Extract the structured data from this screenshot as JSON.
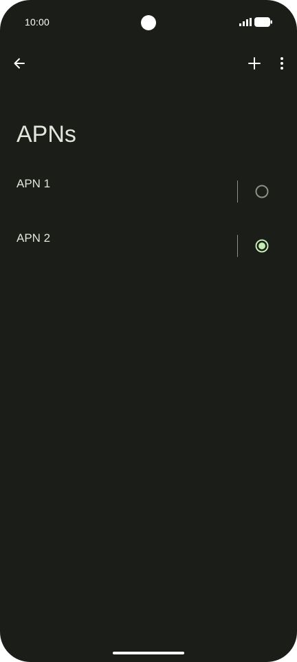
{
  "status_bar": {
    "time": "10:00"
  },
  "app_bar": {
    "back_icon": "arrow-back-icon",
    "add_icon": "add-icon",
    "more_icon": "more-vert-icon"
  },
  "page": {
    "title": "APNs"
  },
  "apns": [
    {
      "label": "APN 1",
      "selected": false
    },
    {
      "label": "APN 2",
      "selected": true
    }
  ],
  "colors": {
    "background": "#1b1d18",
    "text": "#e3e4db",
    "accent": "#c5ebb3",
    "radio_unselected": "#8f9188"
  }
}
